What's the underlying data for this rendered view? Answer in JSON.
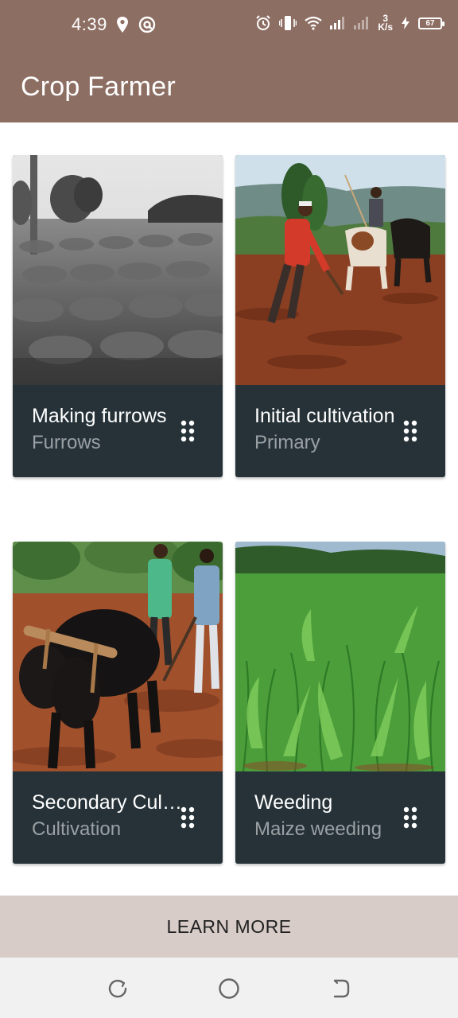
{
  "status_bar": {
    "time": "4:39",
    "net_speed_value": "3",
    "net_speed_unit": "K/s",
    "battery": "67",
    "icons": [
      "location-icon",
      "at-sign-icon",
      "alarm-icon",
      "vibrate-icon",
      "wifi-icon",
      "signal-icon",
      "signal-icon-2",
      "charging-icon",
      "battery-icon"
    ]
  },
  "app_bar": {
    "title": "Crop Farmer",
    "color": "#8d6e63"
  },
  "cards": [
    {
      "title": "Making furrows",
      "subtitle": "Furrows",
      "image": "furrows-photo"
    },
    {
      "title": "Initial cultivation",
      "subtitle": "Primary",
      "image": "ox-plough-photo"
    },
    {
      "title": "Secondary Cultivation",
      "subtitle": "Cultivation",
      "image": "oxen-yoke-photo"
    },
    {
      "title": "Weeding",
      "subtitle": "Maize  weeding",
      "image": "maize-field-photo"
    }
  ],
  "card_color": "#263238",
  "learn_more": {
    "label": "LEARN MORE",
    "color": "#d7ccc8"
  },
  "nav_bar": {
    "buttons": [
      "recents-icon",
      "home-icon",
      "back-icon"
    ]
  }
}
